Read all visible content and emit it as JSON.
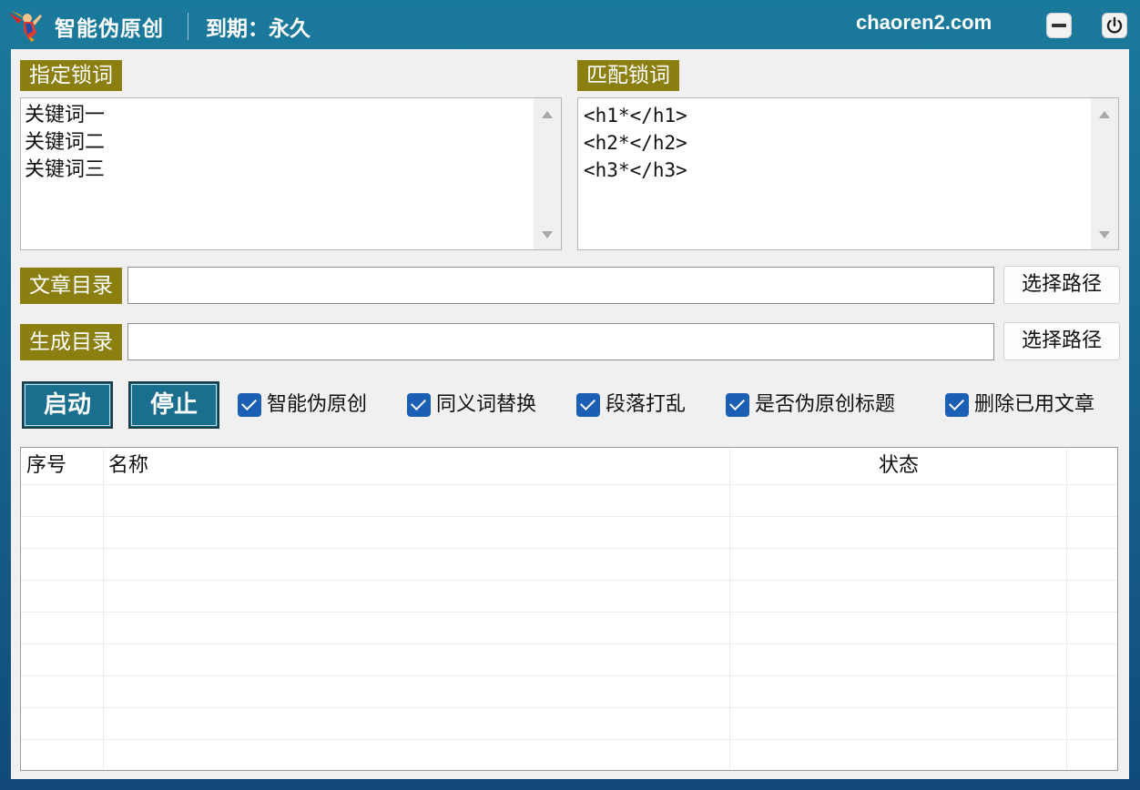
{
  "titlebar": {
    "app_title": "智能伪原创",
    "expiry": "到期：永久",
    "site": "chaoren2.com"
  },
  "lock_words": {
    "label": "指定锁词",
    "items": [
      "关键词一",
      "关键词二",
      "关键词三"
    ]
  },
  "match_lock": {
    "label": "匹配锁词",
    "items": [
      "<h1*</h1>",
      "<h2*</h2>",
      "<h3*</h3>"
    ]
  },
  "article_dir": {
    "label": "文章目录",
    "value": "",
    "button": "选择路径"
  },
  "output_dir": {
    "label": "生成目录",
    "value": "",
    "button": "选择路径"
  },
  "actions": {
    "start": "启动",
    "stop": "停止"
  },
  "options": [
    {
      "label": "智能伪原创",
      "checked": true
    },
    {
      "label": "同义词替换",
      "checked": true
    },
    {
      "label": "段落打乱",
      "checked": true
    },
    {
      "label": "是否伪原创标题",
      "checked": true
    },
    {
      "label": "删除已用文章",
      "checked": true
    }
  ],
  "table": {
    "columns": [
      "序号",
      "名称",
      "状态"
    ],
    "rows": []
  },
  "colors": {
    "titlebar": "#1a7a9c",
    "tag": "#8a7f10",
    "action_button": "#1a6e8e",
    "checkbox": "#1a5fb4"
  }
}
